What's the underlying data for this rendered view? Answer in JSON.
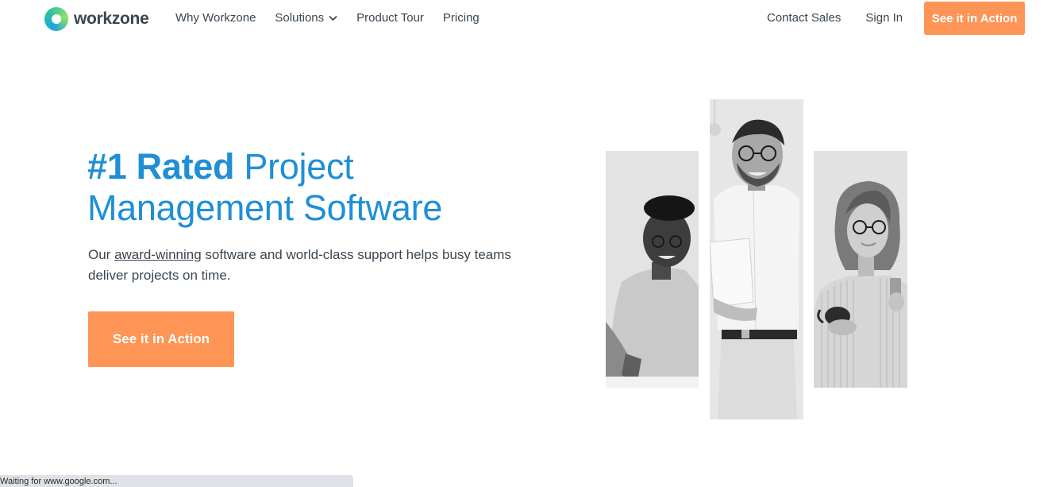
{
  "brand": {
    "name": "workzone"
  },
  "nav": {
    "items": [
      {
        "label": "Why Workzone"
      },
      {
        "label": "Solutions"
      },
      {
        "label": "Product Tour"
      },
      {
        "label": "Pricing"
      }
    ],
    "contact_sales": "Contact Sales",
    "sign_in": "Sign In",
    "cta": "See it in Action"
  },
  "hero": {
    "title_strong": "#1 Rated",
    "title_rest": " Project Management Software",
    "subtitle_before": "Our ",
    "subtitle_link": "award-winning",
    "subtitle_after": " software and world-class support helps busy teams deliver projects on time.",
    "cta": "See it in Action"
  },
  "status_bar": {
    "text": "Waiting for www.google.com..."
  },
  "colors": {
    "accent_orange": "#fe9455",
    "title_blue": "#1f8fd6",
    "text_dark": "#3a4651"
  }
}
